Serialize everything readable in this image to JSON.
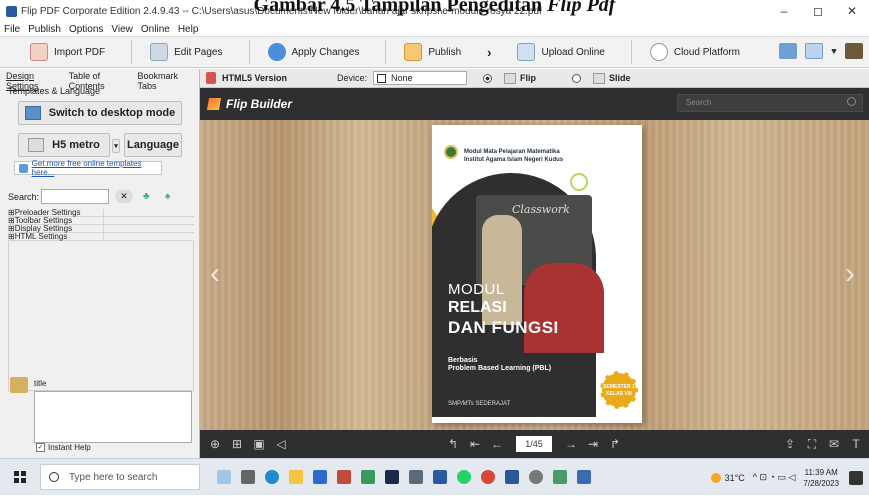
{
  "caption": {
    "prefix": "Gambar 4.5 Tampilan Pengeditan ",
    "italic": "Flip Pdf"
  },
  "window": {
    "title": "Flip PDF Corporate Edition 2.4.9.43 -- C:\\Users\\asus\\Documents\\New folder\\bahan ajar skripsi\\e-module rosya 22.pdf",
    "minimize": "–",
    "maximize": "◻",
    "close": "✕"
  },
  "menu": [
    "File",
    "Publish",
    "Options",
    "View",
    "Online",
    "Help"
  ],
  "toolbar": {
    "import": "Import PDF",
    "edit": "Edit Pages",
    "apply": "Apply Changes",
    "publish": "Publish",
    "upload": "Upload Online",
    "cloud": "Cloud Platform"
  },
  "left_panel": {
    "tabs": [
      "Design Settings",
      "Table of Contents",
      "Bookmark Tabs"
    ],
    "section": "Templates & Language",
    "desktop_mode": "Switch to desktop mode",
    "template": "H5 metro",
    "language": "Language",
    "more_templates": "Get more free online templates here...",
    "search_label": "Search:",
    "settings": [
      "⊞Preloader Settings",
      "⊞Toolbar Settings",
      "⊞Display Settings",
      "⊞HTML Settings"
    ],
    "title_label": "title",
    "instant_help": "Instant Help"
  },
  "preview_bar": {
    "html5": "HTML5 Version",
    "device_label": "Device:",
    "device_value": "None",
    "flip": "Flip",
    "slide": "Slide"
  },
  "flip_viewer": {
    "brand": "Flip Builder",
    "search_placeholder": "Search",
    "page": "1/45"
  },
  "cover": {
    "institution_line1": "Modul Mata Pelajaran Matematika",
    "institution_line2": "Institut Agama Islam Negeri Kudus",
    "classwork": "Classwork",
    "title1": "MODUL",
    "title2": "RELASI",
    "title3": "DAN FUNGSI",
    "sub1": "Berbasis",
    "sub2": "Problem Based Learning (PBL)",
    "grade": "SMP/MTs SEDERAJAT",
    "badge": "SEMESTER 1 KELAS VIII"
  },
  "taskbar": {
    "search": "Type here to search",
    "temp": "31°C",
    "time": "11:39 AM",
    "date": "7/28/2023"
  }
}
